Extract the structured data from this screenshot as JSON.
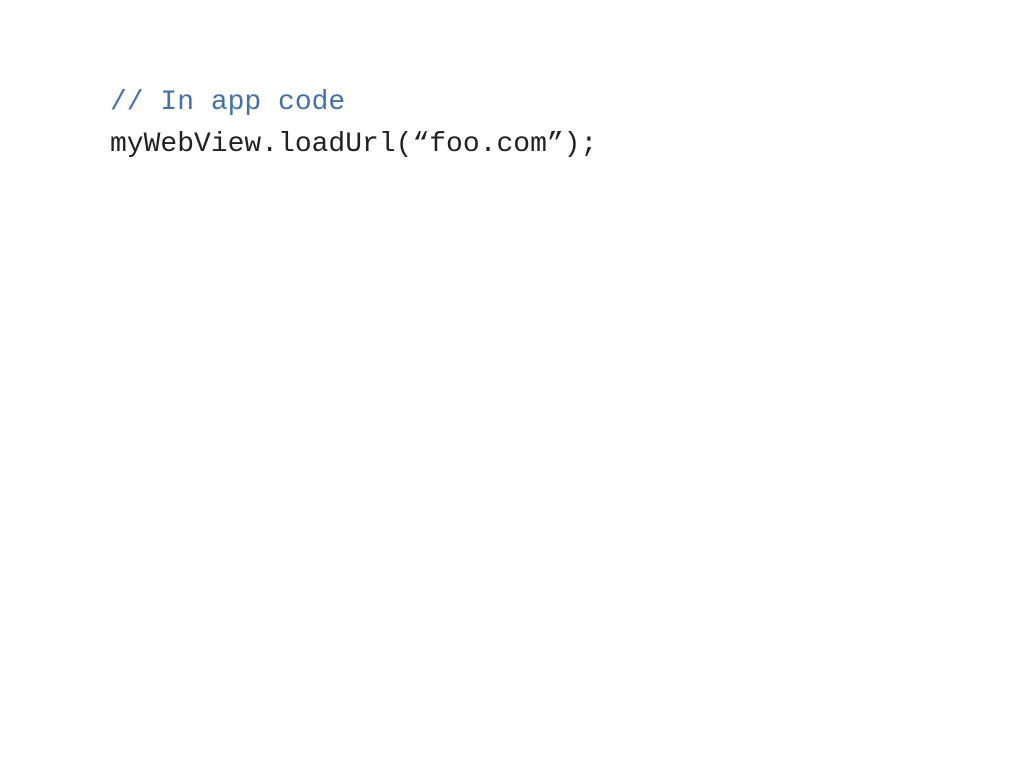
{
  "slide": {
    "comment": "// In app code",
    "code": "myWebView.loadUrl(“foo.com”);"
  }
}
